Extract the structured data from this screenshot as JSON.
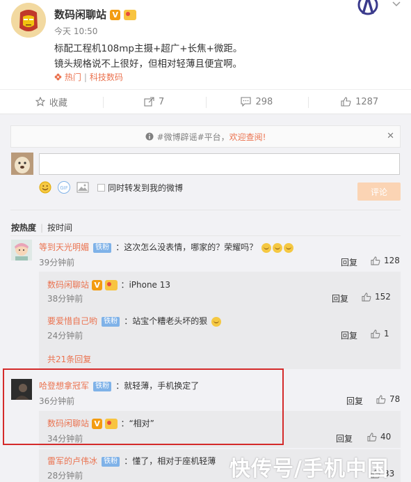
{
  "post": {
    "author": "数码闲聊站",
    "time": "今天 10:50",
    "line1": "标配工程机108mp主摄+超广+长焦+微距。",
    "line2": "镜头规格说不上很好，但相对轻薄且便宜啊。",
    "hot_label": "热门",
    "topic": "科技数码"
  },
  "actions": {
    "favorite": "收藏",
    "repost_count": "7",
    "comment_count": "298",
    "like_count": "1287"
  },
  "notice": {
    "topic": "#微博辟谣#平台，",
    "link": "欢迎查阅!"
  },
  "composer": {
    "repost_option": "同时转发到我的微博",
    "submit_label": "评论"
  },
  "sort": {
    "hot": "按热度",
    "time": "按时间"
  },
  "comments": [
    {
      "name": "等到天光明媚",
      "badge": "铁粉",
      "text": "：这次怎么没表情，哪家的？荣耀吗？",
      "time": "39分钟前",
      "reply": "回复",
      "likes": "128",
      "replies": [
        {
          "name": "数码闲聊站",
          "text": "：iPhone 13",
          "time": "38分钟前",
          "reply": "回复",
          "likes": "152"
        },
        {
          "name": "要爱惜自己哟",
          "badge": "铁粉",
          "text": "：站宝个糟老头坏的狠",
          "time": "24分钟前",
          "reply": "回复",
          "likes": "1"
        }
      ],
      "more": "共21条回复"
    },
    {
      "name": "哈登想拿冠军",
      "badge": "铁粉",
      "text": "：就轻薄，手机换定了",
      "time": "36分钟前",
      "reply": "回复",
      "likes": "78",
      "replies": [
        {
          "name": "数码闲聊站",
          "text": "：“相对”",
          "time": "34分钟前",
          "reply": "回复",
          "likes": "40"
        }
      ]
    },
    {
      "name": "雷军的卢伟冰",
      "badge": "铁粉",
      "text": "：懂了，相对于座机轻薄",
      "time": "28分钟前",
      "likes": "33"
    }
  ],
  "watermark": "快传号/手机中国",
  "colors": {
    "accent": "#eb7350",
    "fan_badge": "#7fb2e8",
    "highlight_box": "#d42a2a"
  }
}
